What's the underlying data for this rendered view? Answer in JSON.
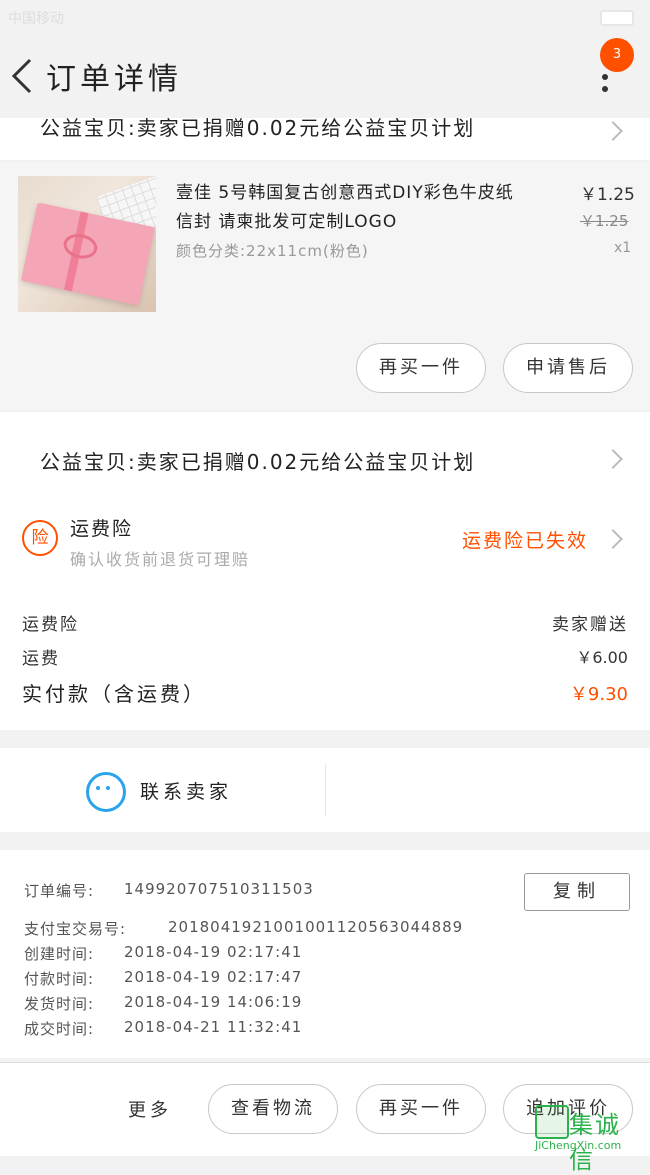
{
  "status_bar": {
    "left": "中国移动",
    "center": ""
  },
  "header": {
    "title": "订单详情",
    "badge": "3"
  },
  "top_partial": {
    "text": "公益宝贝:卖家已捐赠0.02元给公益宝贝计划"
  },
  "product": {
    "name_line1": "壹佳 5号韩国复古创意西式DIY彩色牛皮纸",
    "name_line2": "信封 请柬批发可定制LOGO",
    "spec": "颜色分类:22x11cm(粉色)",
    "price": "￥1.25",
    "original_price": "￥1.25",
    "quantity": "x1",
    "buy_again_label": "再买一件",
    "after_sale_label": "申请售后"
  },
  "charity": {
    "text": "公益宝贝:卖家已捐赠0.02元给公益宝贝计划"
  },
  "insurance": {
    "icon_text": "险",
    "title": "运费险",
    "subtitle": "确认收货前退货可理赔",
    "status": "运费险已失效",
    "status_color": "#ff5000"
  },
  "fees": [
    {
      "label": "运费险",
      "value": "卖家赠送"
    },
    {
      "label": "运费",
      "value": "￥6.00"
    }
  ],
  "total": {
    "label": "实付款（含运费）",
    "value": "￥9.30",
    "color": "#ff5000"
  },
  "contact": {
    "label": "联系卖家"
  },
  "order_info": {
    "order_no_label": "订单编号:",
    "order_no": "149920707510311503",
    "copy_label": "复制",
    "rows": [
      {
        "label": "支付宝交易号:",
        "value": "2018041921001001120563044889"
      },
      {
        "label": "创建时间:",
        "value": "2018-04-19 02:17:41"
      },
      {
        "label": "付款时间:",
        "value": "2018-04-19 02:17:47"
      },
      {
        "label": "发货时间:",
        "value": "2018-04-19 14:06:19"
      },
      {
        "label": "成交时间:",
        "value": "2018-04-21 11:32:41"
      }
    ]
  },
  "bottom_bar": {
    "more_label": "更多",
    "logistics_label": "查看物流",
    "buy_again_label": "再买一件",
    "review_label": "追加评价"
  },
  "watermark": {
    "text": "集诚信",
    "sub": "JiChengXin.com"
  }
}
